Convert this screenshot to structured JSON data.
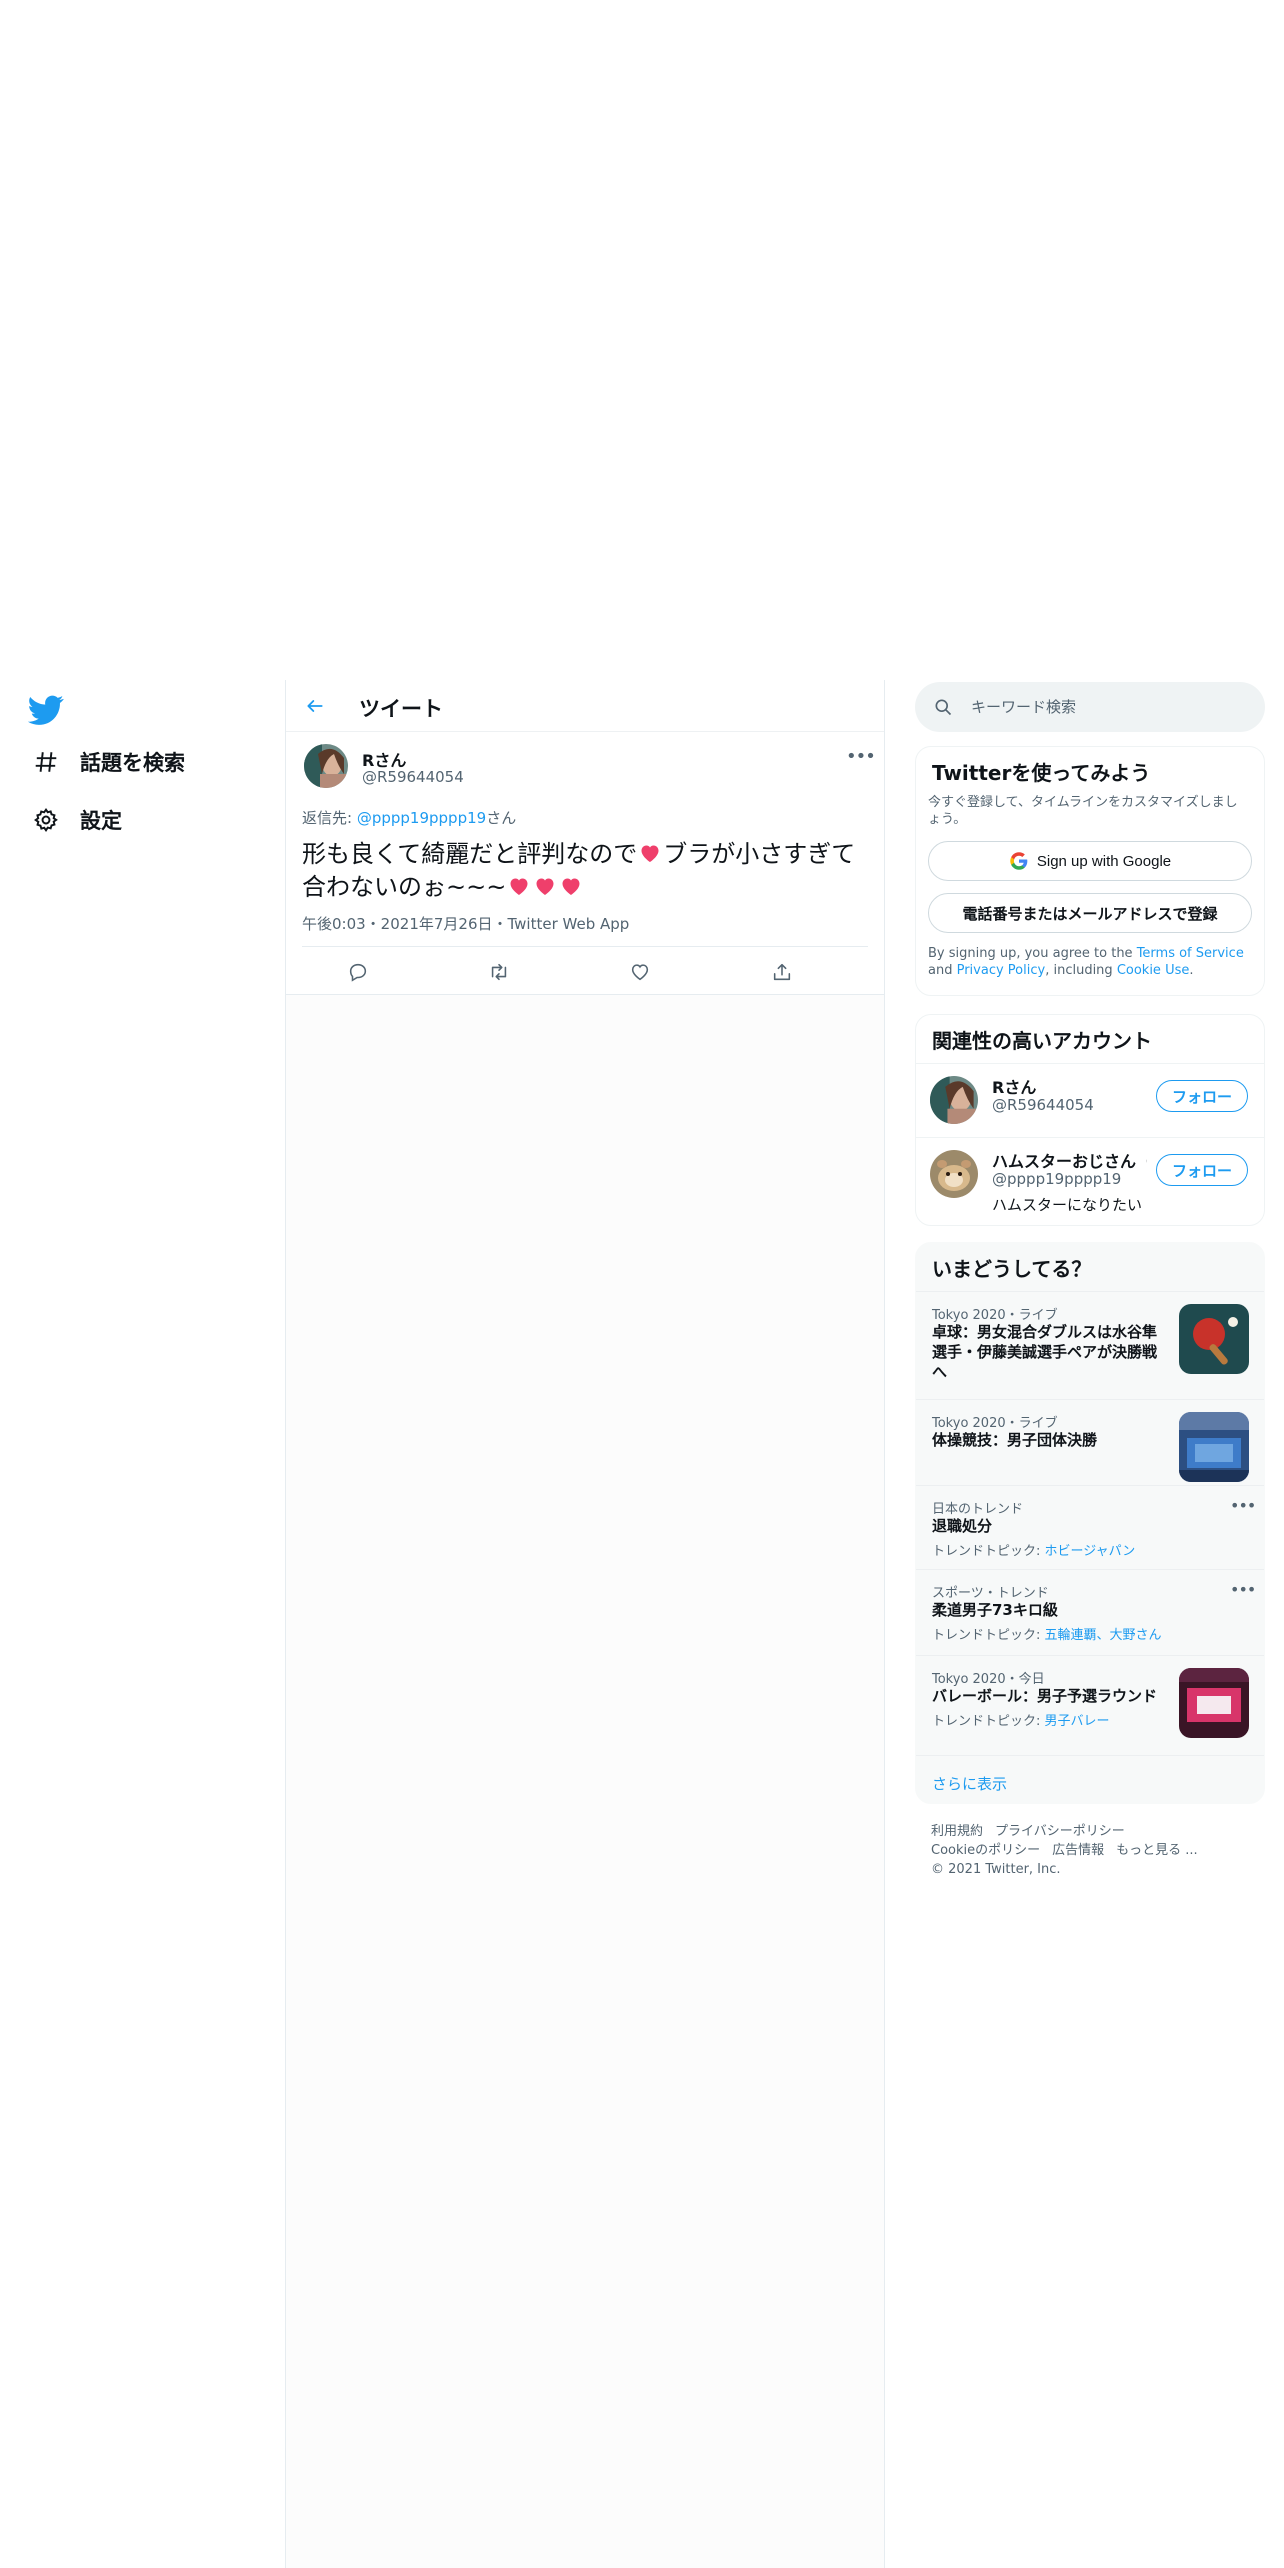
{
  "nav": {
    "logo": "twitter-bird-icon",
    "items": [
      {
        "label": "話題を検索",
        "icon": "hashtag-icon"
      },
      {
        "label": "設定",
        "icon": "gear-icon"
      }
    ]
  },
  "header": {
    "title": "ツイート"
  },
  "tweet": {
    "author_name": "Rさん",
    "author_handle": "@R59644054",
    "reply_prefix": "返信先: ",
    "reply_mention": "@pppp19pppp19",
    "reply_suffix": "さん",
    "text_part1": "形も良くて綺麗だと評判なので",
    "text_part2": "ブラが小さすぎて合わないのぉ~~~",
    "meta": "午後0:03・2021年7月26日・Twitter Web App"
  },
  "search": {
    "placeholder": "キーワード検索"
  },
  "join": {
    "title": "Twitterを使ってみよう",
    "subtitle": "今すぐ登録して、タイムラインをカスタマイズしましょう。",
    "google_btn": "Sign up with Google",
    "signup_btn": "電話番号またはメールアドレスで登録",
    "legal_1": "By signing up, you agree to the ",
    "legal_tos": "Terms of Service",
    "legal_2": " and ",
    "legal_privacy": "Privacy Policy",
    "legal_3": ", including ",
    "legal_cookie": "Cookie Use",
    "legal_4": "."
  },
  "related": {
    "title": "関連性の高いアカウント",
    "accounts": [
      {
        "name": "Rさん",
        "handle": "@R59644054",
        "bio": "",
        "follow": "フォロー"
      },
      {
        "name": "ハムスターおじさん（",
        "handle": "@pppp19pppp19",
        "bio": "ハムスターになりたい",
        "follow": "フォロー"
      }
    ]
  },
  "trends": {
    "title": "いまどうしてる？",
    "items": [
      {
        "category": "Tokyo 2020・ライブ",
        "title": "卓球：男女混合ダブルスは水谷隼選手・伊藤美誠選手ペアが決勝戦へ",
        "topic_label": "",
        "topic_links": ""
      },
      {
        "category": "Tokyo 2020・ライブ",
        "title": "体操競技：男子団体決勝",
        "topic_label": "",
        "topic_links": ""
      },
      {
        "category": "日本のトレンド",
        "title": "退職処分",
        "topic_label": "トレンドトピック: ",
        "topic_links": "ホビージャパン"
      },
      {
        "category": "スポーツ・トレンド",
        "title": "柔道男子73キロ級",
        "topic_label": "トレンドトピック: ",
        "topic_links": "五輪連覇、大野さん"
      },
      {
        "category": "Tokyo 2020・今日",
        "title": "バレーボール：男子予選ラウンド",
        "topic_label": "トレンドトピック: ",
        "topic_links": "男子バレー"
      }
    ],
    "show_more": "さらに表示"
  },
  "footer": {
    "terms": "利用規約",
    "privacy": "プライバシーポリシー",
    "cookie": "Cookieのポリシー",
    "ads": "広告情報",
    "more": "もっと見る ...",
    "copyright": "© 2021 Twitter, Inc."
  },
  "colors": {
    "accent": "#1d9bf0",
    "text": "#0f1419",
    "muted": "#536471",
    "border": "#eff3f4"
  }
}
